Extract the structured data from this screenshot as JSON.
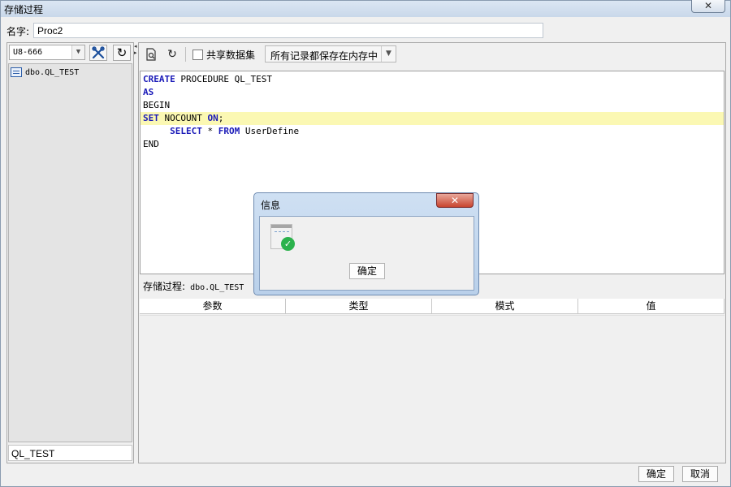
{
  "window": {
    "title": "存储过程",
    "close_glyph": "✕"
  },
  "name_field": {
    "label": "名字:",
    "value": "Proc2"
  },
  "left": {
    "connection": "U8-666",
    "tree_items": [
      "dbo.QL_TEST"
    ],
    "bottom_value": "QL_TEST"
  },
  "toolbar": {
    "share_label": "共享数据集",
    "memory_mode": "所有记录都保存在内存中"
  },
  "code": [
    [
      {
        "t": "CREATE",
        "k": true
      },
      {
        "t": " PROCEDURE QL_TEST",
        "k": false
      }
    ],
    [
      {
        "t": "AS",
        "k": true
      }
    ],
    [
      {
        "t": "BEGIN",
        "k": false
      }
    ],
    [
      {
        "t": "SET",
        "k": true
      },
      {
        "t": " NOCOUNT ",
        "k": false
      },
      {
        "t": "ON",
        "k": true
      },
      {
        "t": ";",
        "k": false
      }
    ],
    [
      {
        "t": "     ",
        "k": false
      },
      {
        "t": "SELECT",
        "k": true
      },
      {
        "t": " * ",
        "k": false
      },
      {
        "t": "FROM",
        "k": true
      },
      {
        "t": " UserDefine",
        "k": false
      }
    ],
    [
      {
        "t": "END",
        "k": false
      }
    ]
  ],
  "highlight_line": 3,
  "status": {
    "label": "存储过程:",
    "value": " dbo.QL_TEST"
  },
  "grid_columns": [
    "参数",
    "类型",
    "模式",
    "值"
  ],
  "footer": {
    "ok_label": "确定",
    "cancel_label": "取消"
  },
  "dialog": {
    "title": "信息",
    "close_glyph": "✕",
    "ok_label": "确定"
  },
  "colors": {
    "keyword": "#1a1ab8",
    "highlight": "#fbf8b3",
    "success": "#2bb24c"
  }
}
